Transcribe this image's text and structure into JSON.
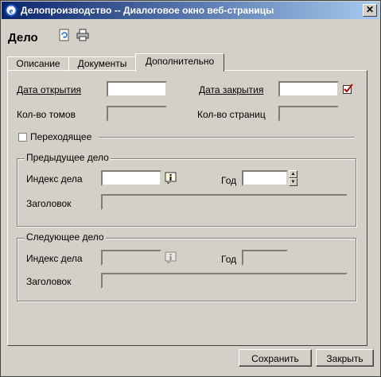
{
  "window": {
    "title": "Делопроизводство -- Диалоговое окно веб-страницы",
    "close_glyph": "✕"
  },
  "header": {
    "title": "Дело"
  },
  "tabs": [
    {
      "label": "Описание",
      "active": false
    },
    {
      "label": "Документы",
      "active": false
    },
    {
      "label": "Дополнительно",
      "active": true
    }
  ],
  "form": {
    "open_date_label": "Дата открытия",
    "open_date_value": "",
    "close_date_label": "Дата закрытия",
    "close_date_value": "",
    "volumes_label": "Кол-во томов",
    "volumes_value": "",
    "pages_label": "Кол-во страниц",
    "pages_value": "",
    "transitional_label": "Переходящее",
    "transitional_checked": false
  },
  "previous_case": {
    "legend": "Предыдущее дело",
    "index_label": "Индекс дела",
    "index_value": "",
    "year_label": "Год",
    "year_value": "",
    "title_label": "Заголовок",
    "title_value": ""
  },
  "next_case": {
    "legend": "Следующее дело",
    "index_label": "Индекс дела",
    "index_value": "",
    "year_label": "Год",
    "year_value": "",
    "title_label": "Заголовок",
    "title_value": ""
  },
  "buttons": {
    "save": "Сохранить",
    "close": "Закрыть"
  },
  "colors": {
    "titlebar_start": "#0a246a",
    "titlebar_end": "#a6caf0",
    "face": "#d4d0c8",
    "check_mark": "#c00000"
  }
}
